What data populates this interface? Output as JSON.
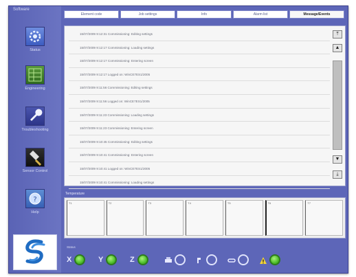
{
  "sidebar": {
    "title": "Software",
    "items": [
      {
        "label": "Status",
        "icon": "gear-icon"
      },
      {
        "label": "Engineering",
        "icon": "board-icon"
      },
      {
        "label": "Troubleshooting",
        "icon": "wrench-icon"
      },
      {
        "label": "Sensor Control",
        "icon": "sensor-icon"
      },
      {
        "label": "Help",
        "icon": "help-icon"
      }
    ],
    "logo": "company-logo"
  },
  "tabs": [
    {
      "label": "Element code"
    },
    {
      "label": "Job settings"
    },
    {
      "label": "Info"
    },
    {
      "label": "Alarm list"
    },
    {
      "label": "Message/Events"
    }
  ],
  "log": {
    "entries": [
      "15/07/2009 9:12:31 Commissioning: Editing settings",
      "15/07/2009 9:12:17 Commissioning: Loading settings",
      "15/07/2009 9:12:17 Commissioning: Entering screen",
      "15/07/2009 9:12:17 Logged on: WinCE7ES1/2005",
      "15/07/2009 9:11:56 Commissioning: Editing settings",
      "15/07/2009 9:11:56 Logged on: WinCE7ES1/2005",
      "15/07/2009 9:11:23 Commissioning: Loading settings",
      "15/07/2009 9:11:23 Commissioning: Entering screen",
      "15/07/2009 9:10:45 Commissioning: Editing settings",
      "15/07/2009 9:10:41 Commissioning: Entering screen",
      "15/07/2009 9:10:41 Logged on: WinCE7ES1/2005",
      "15/07/2009 9:10:41 Commissioning: Loading settings"
    ]
  },
  "temperature": {
    "title": "Temperature",
    "cells": [
      "T1",
      "T2",
      "T3",
      "T4",
      "T5",
      "T6",
      "T7"
    ]
  },
  "status": {
    "label": "Status",
    "items": [
      {
        "letter": "X",
        "state": "on"
      },
      {
        "letter": "Y",
        "state": "on"
      },
      {
        "letter": "Z",
        "state": "on"
      },
      {
        "glyph": "printer-icon",
        "state": "off"
      },
      {
        "glyph": "clamp-icon",
        "state": "off"
      },
      {
        "glyph": "link-icon",
        "state": "off"
      },
      {
        "glyph": "warning-icon",
        "state": "on"
      }
    ]
  },
  "colors": {
    "frame": "#5d66b8",
    "status_on": "#4fbf2c"
  }
}
